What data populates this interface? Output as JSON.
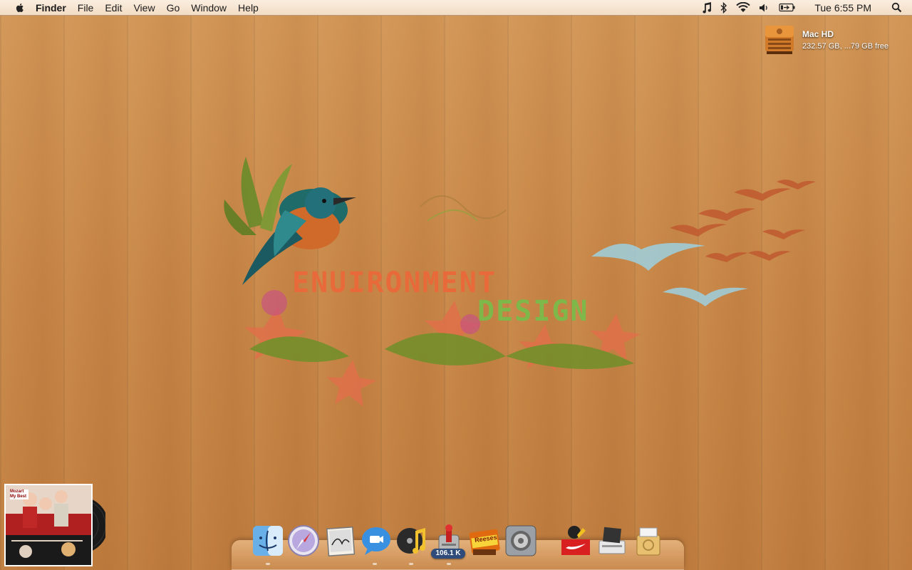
{
  "menubar": {
    "app_name": "Finder",
    "items": [
      "File",
      "Edit",
      "View",
      "Go",
      "Window",
      "Help"
    ],
    "clock": "Tue 6:55 PM"
  },
  "desktop": {
    "drive_name": "Mac HD",
    "drive_info": "232.57 GB, ...79 GB free"
  },
  "wallpaper": {
    "text_line1": "ENUIRONMENT",
    "text_line2": "DESIGN"
  },
  "album": {
    "cover_text": "Mozart My Best"
  },
  "dock": {
    "transmission_badge": "106.1 K",
    "apps": [
      "finder-icon",
      "safari-icon",
      "preview-icon",
      "ichat-icon",
      "itunes-icon",
      "transmission-icon",
      "reeses-icon",
      "system-preferences-icon",
      "nike-icon",
      "downloads-icon",
      "trash-icon"
    ],
    "reeses_label": "Reeses"
  }
}
